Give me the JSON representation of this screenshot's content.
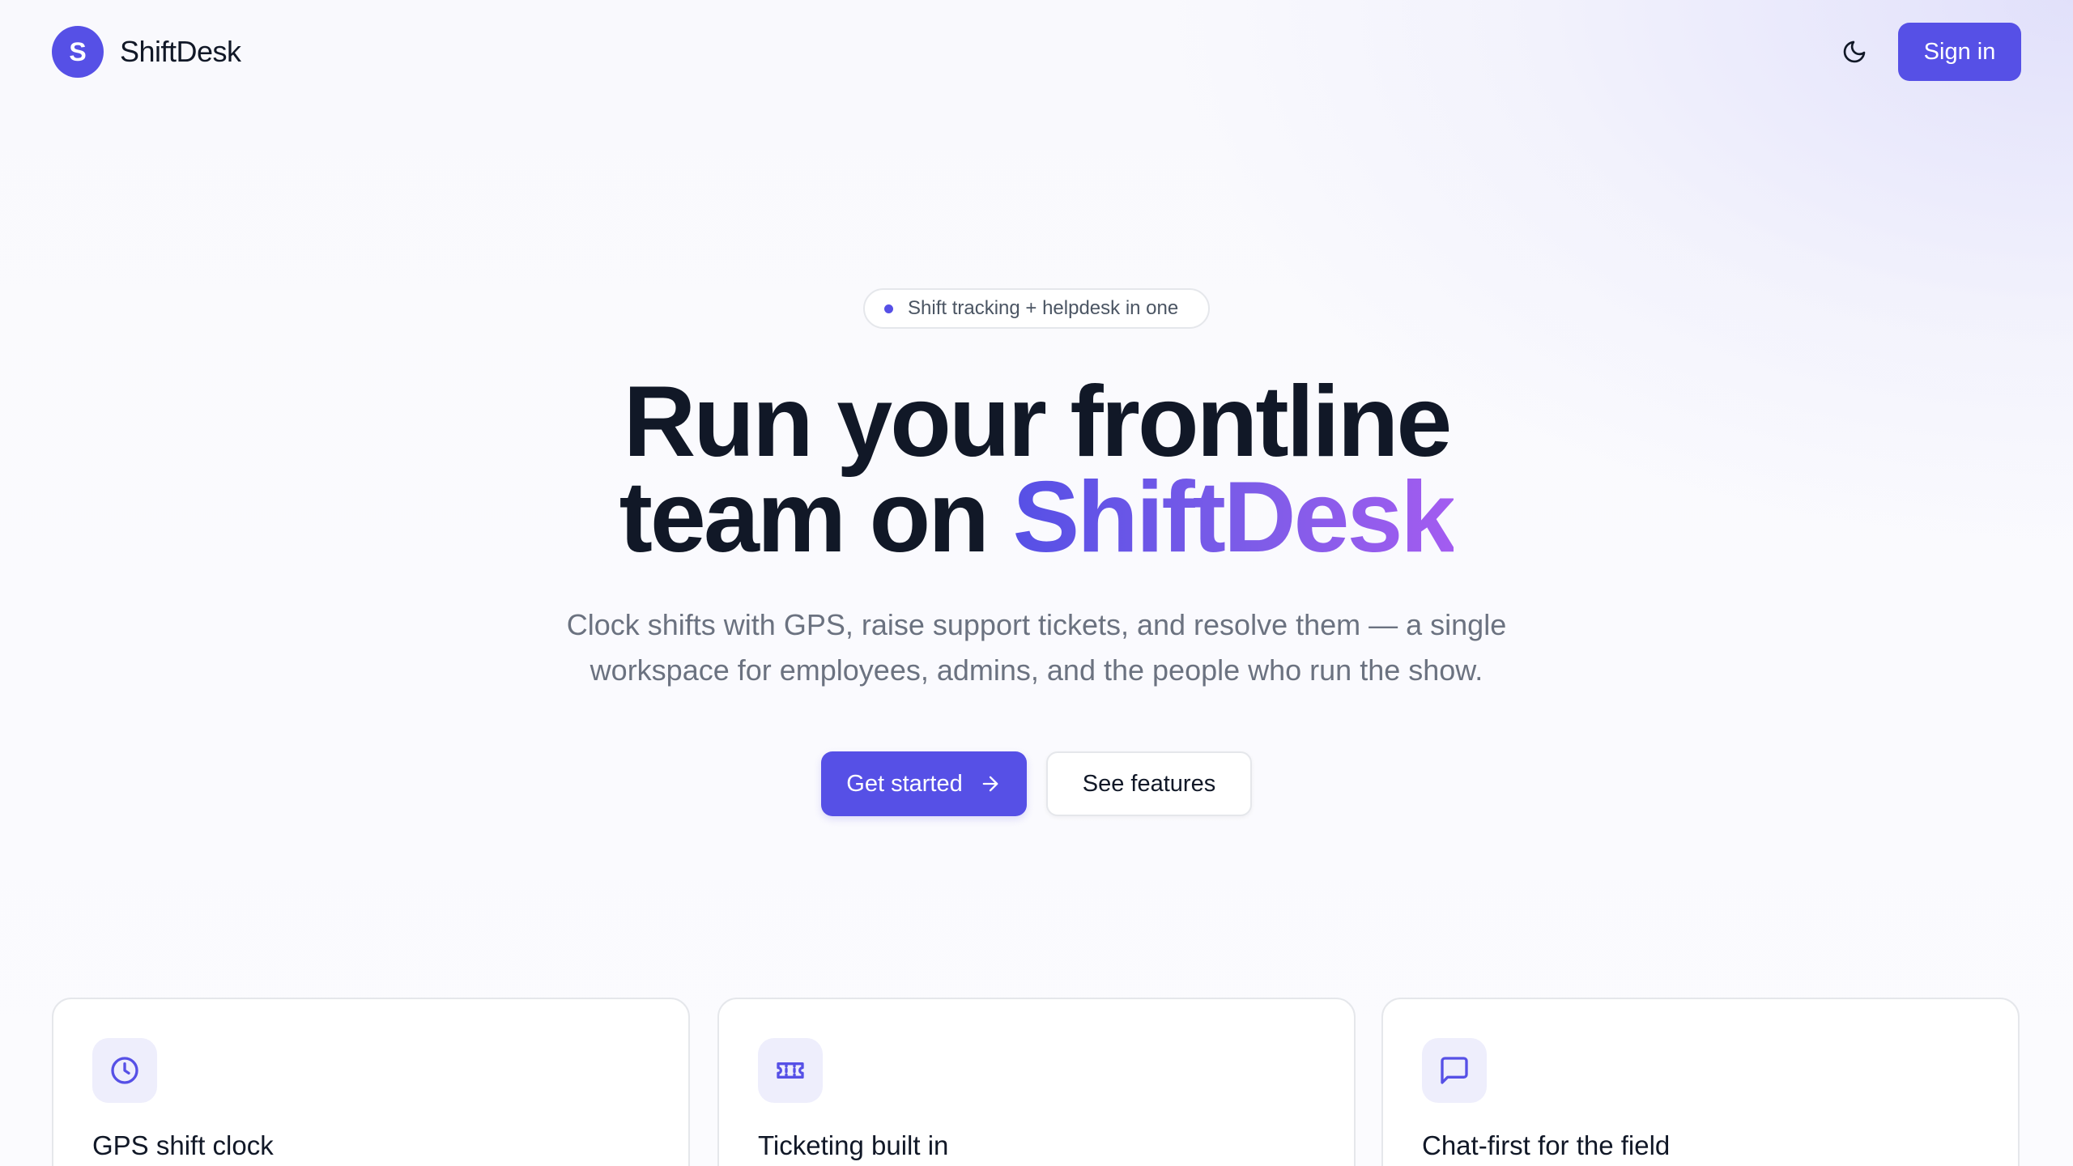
{
  "header": {
    "logo_letter": "S",
    "brand_name": "ShiftDesk",
    "theme_toggle_icon": "moon-icon",
    "signin_label": "Sign in"
  },
  "hero": {
    "pill_text": "Shift tracking + helpdesk in one",
    "title_line1": "Run your frontline",
    "title_line2_prefix": "team on ",
    "title_line2_accent": "ShiftDesk",
    "subtitle_line1": "Clock shifts with GPS, raise support tickets, and resolve them — a single",
    "subtitle_line2": "workspace for employees, admins, and the people who run the show.",
    "primary_cta": "Get started",
    "primary_cta_icon": "arrow-right-icon",
    "secondary_cta": "See features"
  },
  "features": [
    {
      "icon": "clock-icon",
      "title": "GPS shift clock"
    },
    {
      "icon": "ticket-icon",
      "title": "Ticketing built in"
    },
    {
      "icon": "chat-icon",
      "title": "Chat-first for the field"
    }
  ],
  "colors": {
    "accent": "#5650e6",
    "accent_gradient_end": "#a35cf0",
    "text_primary": "#111827",
    "text_muted": "#6b7280",
    "border": "#e5e7eb",
    "icon_tile": "#eeeefc"
  }
}
